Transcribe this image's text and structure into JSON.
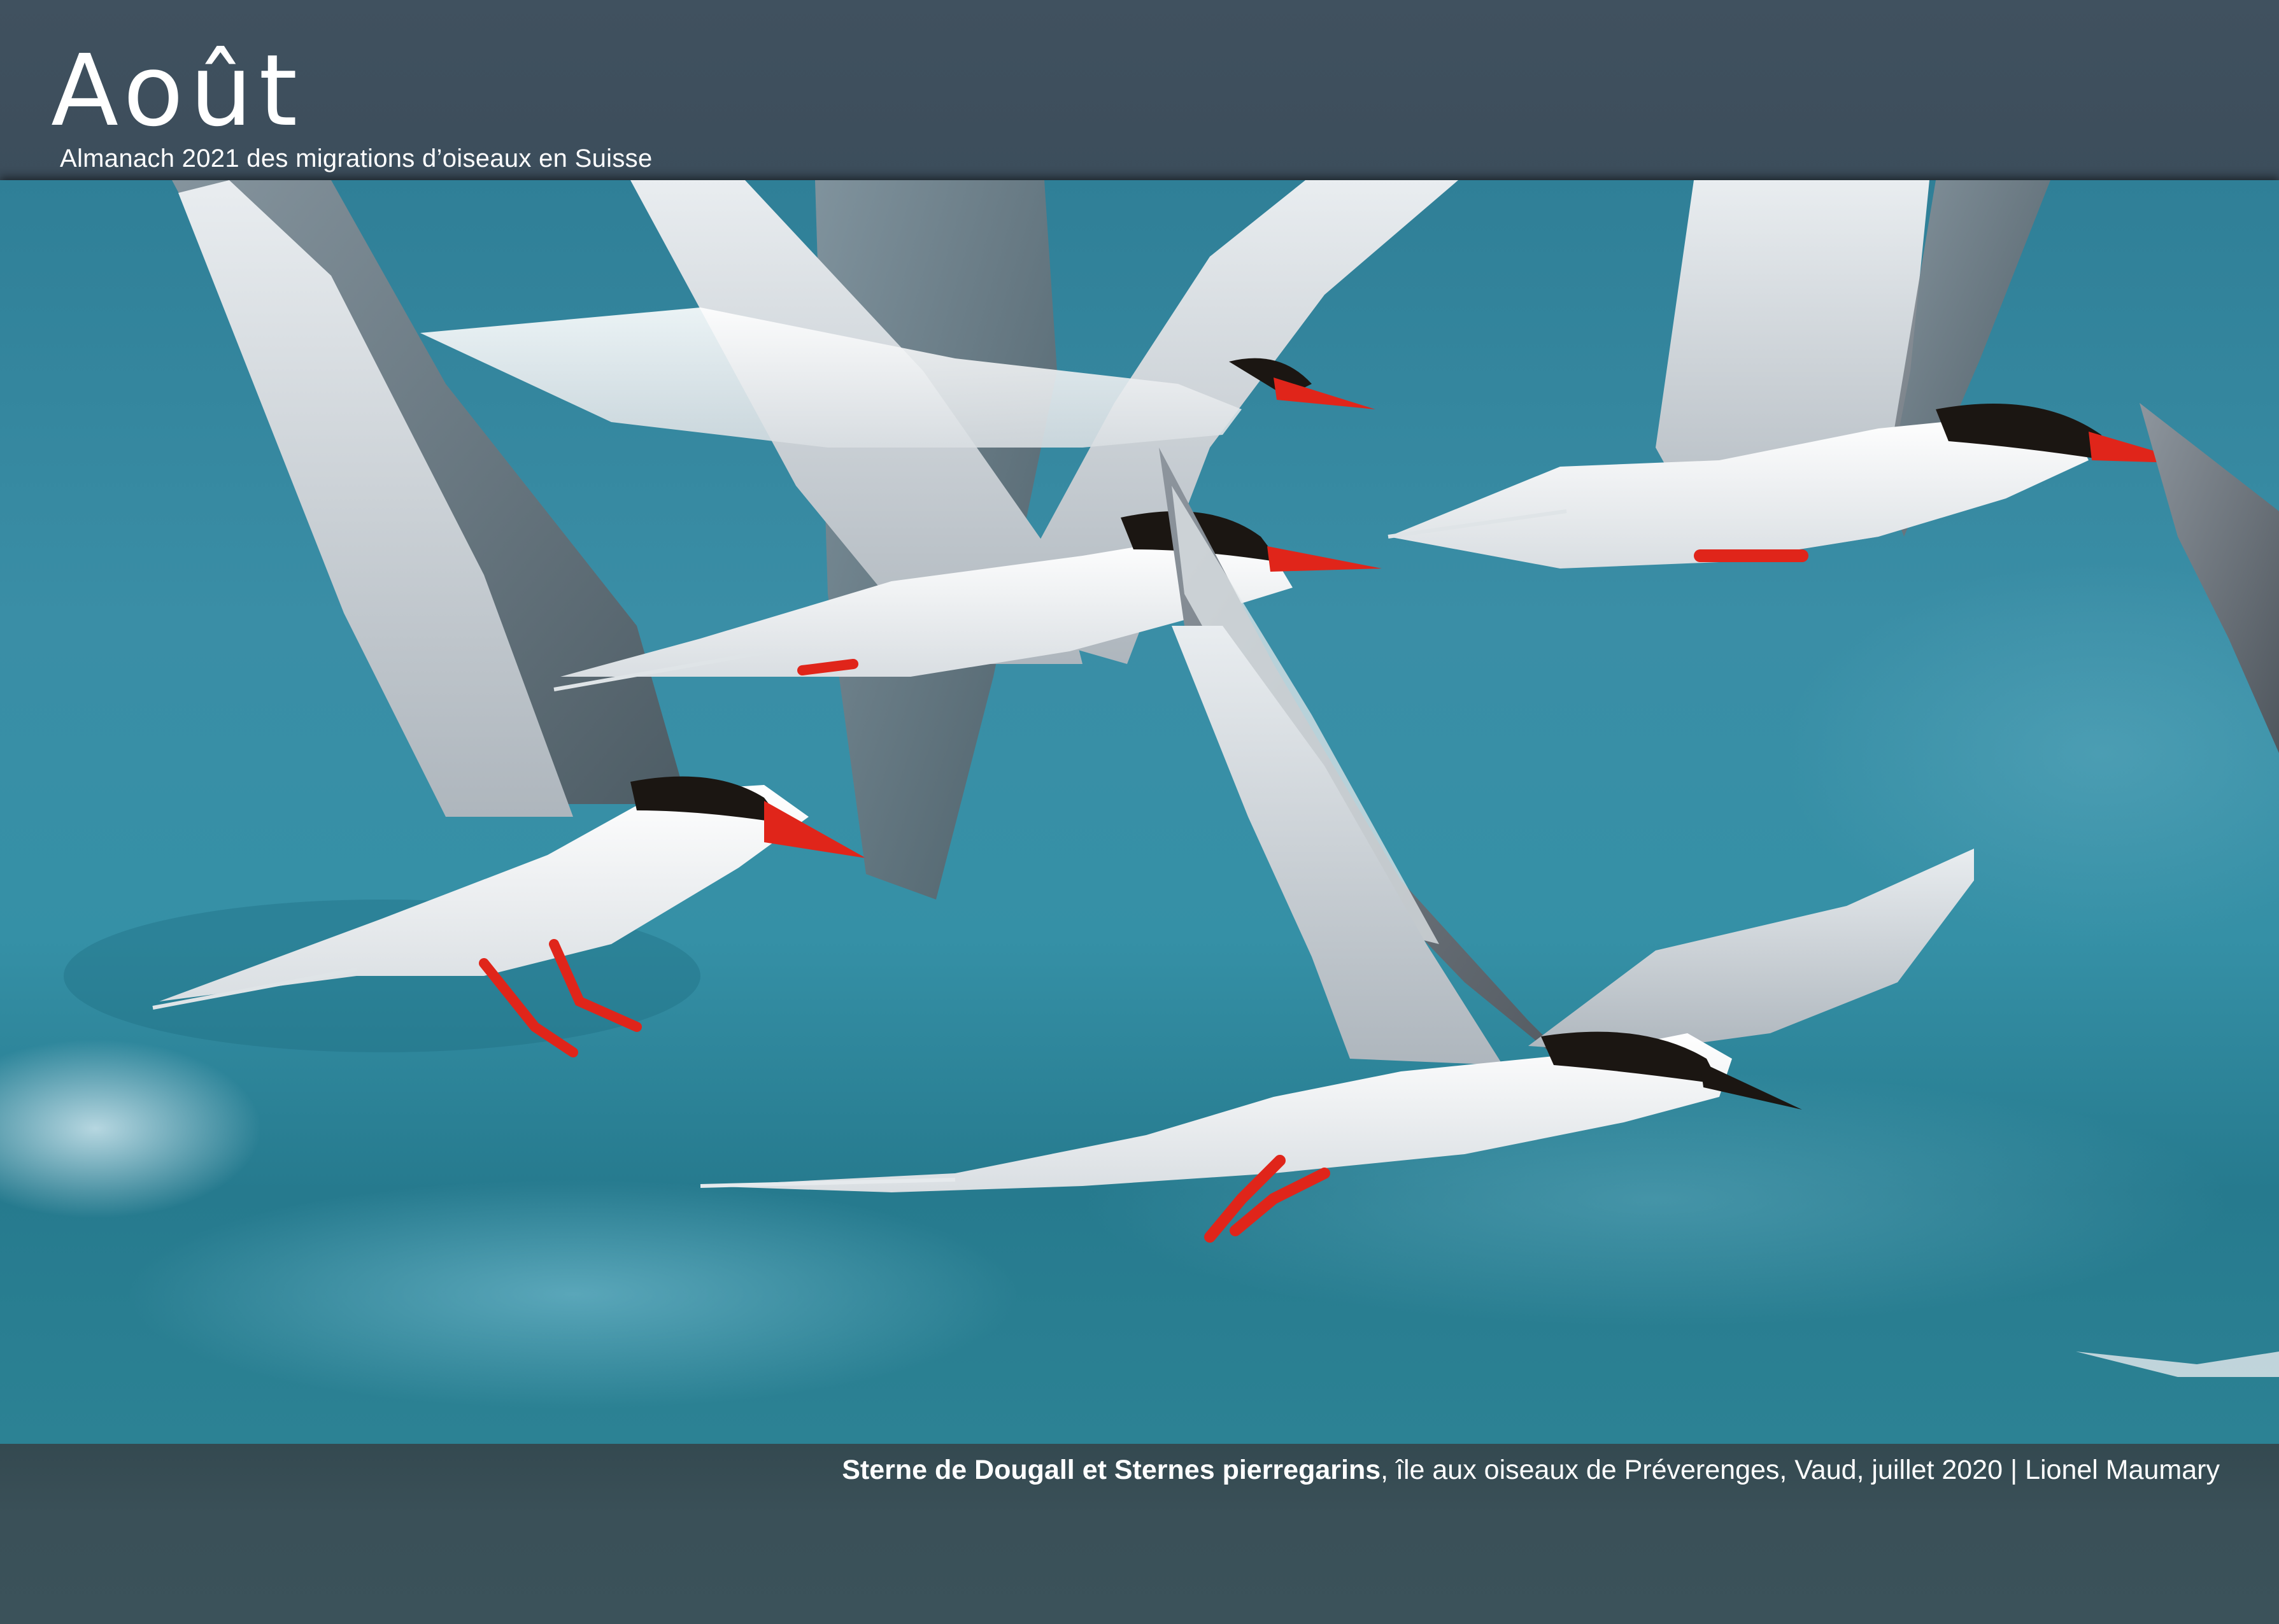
{
  "header": {
    "month": "Août",
    "subtitle": "Almanach 2021 des migrations d’oiseaux en Suisse"
  },
  "photo": {
    "subject": "Terns in flight over blue water",
    "colors": {
      "water_light": "#4a9fb6",
      "water_dark": "#1f6f86",
      "bird_white": "#f2f4f5",
      "wing_grey": "#9aa3ab",
      "cap_black": "#1b1612",
      "bill_red": "#e0251a"
    }
  },
  "caption": {
    "species": "Sterne de Dougall et Sternes pierregarins",
    "details": ", île aux oiseaux de Préverenges, Vaud, juillet 2020 | Lionel Maumary"
  },
  "colors": {
    "header_bg": "#3e4f5d",
    "footer_bg": "#3a5058",
    "text": "#ffffff"
  }
}
